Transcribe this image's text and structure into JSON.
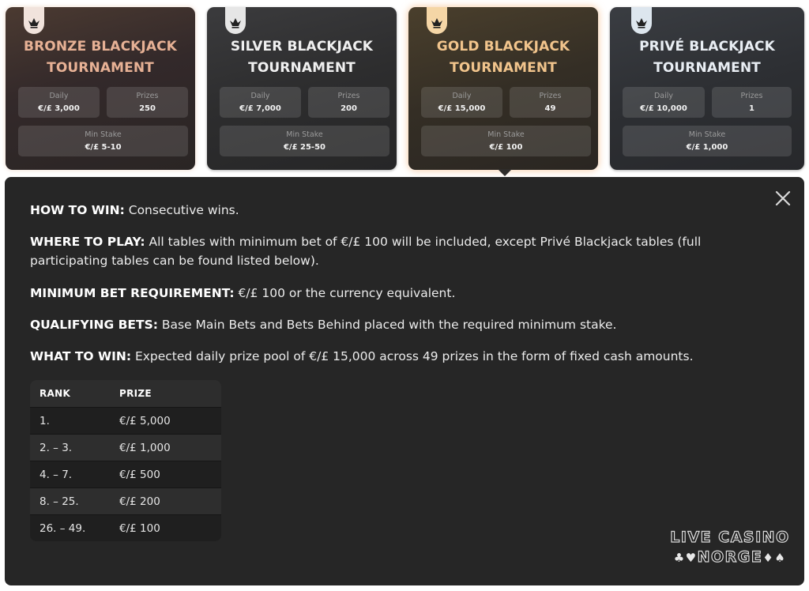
{
  "cards": [
    {
      "tier": "bronze",
      "title_line1": "BRONZE BLACKJACK",
      "title_line2": "TOURNAMENT",
      "daily_label": "Daily",
      "daily_value": "€/£ 3,000",
      "prizes_label": "Prizes",
      "prizes_value": "250",
      "stake_label": "Min Stake",
      "stake_value": "€/£ 5-10"
    },
    {
      "tier": "silver",
      "title_line1": "SILVER BLACKJACK",
      "title_line2": "TOURNAMENT",
      "daily_label": "Daily",
      "daily_value": "€/£ 7,000",
      "prizes_label": "Prizes",
      "prizes_value": "200",
      "stake_label": "Min Stake",
      "stake_value": "€/£ 25-50"
    },
    {
      "tier": "gold",
      "title_line1": "GOLD BLACKJACK",
      "title_line2": "TOURNAMENT",
      "daily_label": "Daily",
      "daily_value": "€/£ 15,000",
      "prizes_label": "Prizes",
      "prizes_value": "49",
      "stake_label": "Min Stake",
      "stake_value": "€/£ 100"
    },
    {
      "tier": "prive",
      "title_line1": "PRIVÉ BLACKJACK",
      "title_line2": "TOURNAMENT",
      "daily_label": "Daily",
      "daily_value": "€/£ 10,000",
      "prizes_label": "Prizes",
      "prizes_value": "1",
      "stake_label": "Min Stake",
      "stake_value": "€/£ 1,000"
    }
  ],
  "selected_card": "gold",
  "details": {
    "how_to_win_label": "HOW TO WIN:",
    "how_to_win_text": " Consecutive wins.",
    "where_label": "WHERE TO PLAY:",
    "where_text": " All tables with minimum bet of €/£ 100 will be included, except Privé Blackjack tables (full participating tables can be found listed below).",
    "min_bet_label": "MINIMUM BET REQUIREMENT:",
    "min_bet_text": " €/£ 100 or the currency equivalent.",
    "qualifying_label": "QUALIFYING BETS:",
    "qualifying_text": " Base Main Bets and Bets Behind placed with the required minimum stake.",
    "what_label": "WHAT TO WIN:",
    "what_text": " Expected daily prize pool of €/£ 15,000 across 49 prizes in the form of fixed cash amounts."
  },
  "prize_table": {
    "headers": [
      "RANK",
      "PRIZE"
    ],
    "rows": [
      [
        "1.",
        "€/£ 5,000"
      ],
      [
        "2. – 3.",
        "€/£ 1,000"
      ],
      [
        "4. – 7.",
        "€/£ 500"
      ],
      [
        "8. – 25.",
        "€/£ 200"
      ],
      [
        "26. – 49.",
        "€/£ 100"
      ]
    ]
  },
  "logo": {
    "line1": "LIVE CASINO",
    "line2": "NORGE",
    "suits_left": "♣♥",
    "suits_right": "♦♠"
  },
  "icons": {
    "badge": "crown-icon",
    "close": "close-icon"
  }
}
